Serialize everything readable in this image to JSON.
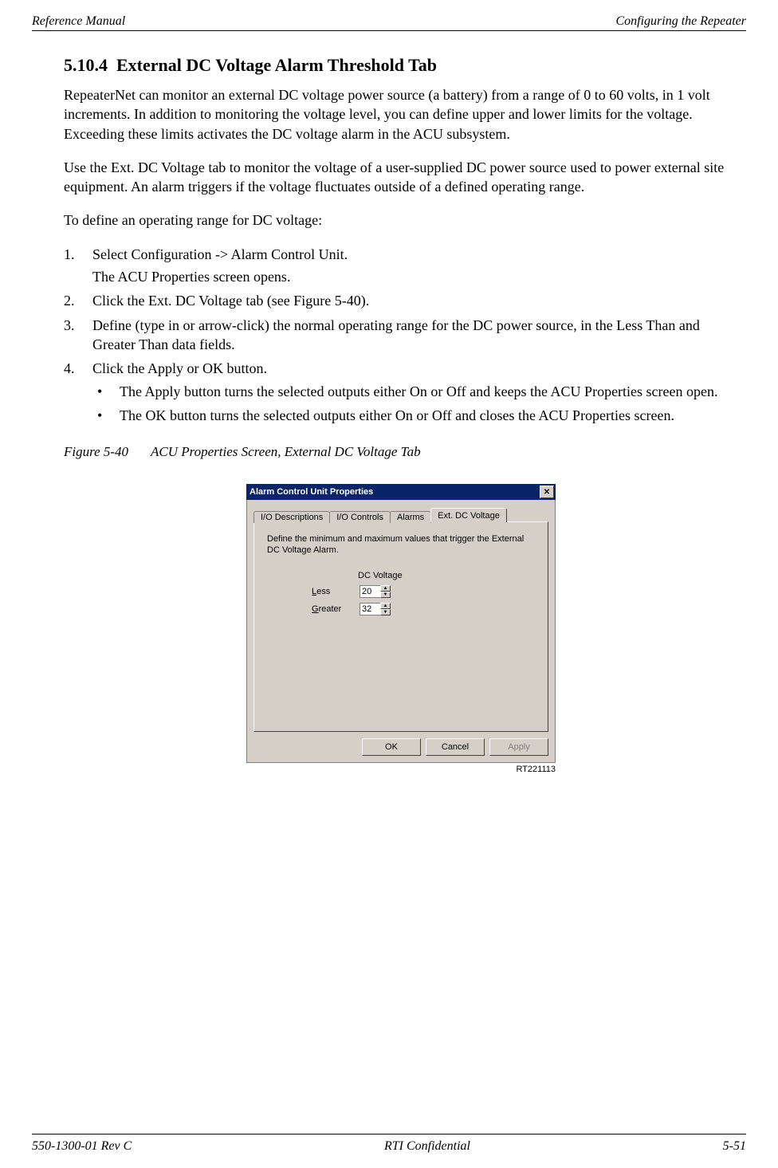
{
  "header": {
    "left": "Reference Manual",
    "right": "Configuring the Repeater"
  },
  "footer": {
    "left": "550-1300-01 Rev C",
    "center": "RTI Confidential",
    "right": "5-51"
  },
  "section": {
    "number": "5.10.4",
    "title": "External DC Voltage Alarm Threshold Tab"
  },
  "paras": {
    "p1": "RepeaterNet can monitor an external DC voltage power source (a battery) from a range of 0 to 60 volts, in 1 volt increments. In addition to monitoring the voltage level, you can define upper and lower limits for the voltage. Exceeding these limits activates the DC voltage alarm in the ACU subsystem.",
    "p2": "Use the Ext. DC Voltage tab to monitor the voltage of a user-supplied DC power source used to power external site equipment. An alarm triggers if the voltage fluctuates outside of a defined operating range.",
    "p3": "To define an operating range for DC voltage:"
  },
  "steps": {
    "s1": "Select Configuration -> Alarm Control Unit.",
    "s1b": "The ACU Properties screen opens.",
    "s2": "Click the Ext. DC Voltage tab (see Figure 5-40).",
    "s3": "Define (type in or arrow-click) the normal operating range for the DC power source, in the Less Than and Greater Than data fields.",
    "s4": "Click the Apply or OK button.",
    "b1": "The Apply button turns the selected outputs either On or Off and keeps the ACU Properties screen open.",
    "b2": "The OK button turns the selected outputs either On or Off and closes the ACU Properties screen."
  },
  "figure": {
    "ref": "Figure 5-40",
    "title": "ACU Properties Screen, External DC Voltage Tab",
    "image_ref": "RT221113"
  },
  "dialog": {
    "title": "Alarm Control Unit Properties",
    "close": "✕",
    "tabs": {
      "t1": "I/O Descriptions",
      "t2": "I/O Controls",
      "t3": "Alarms",
      "t4": "Ext. DC Voltage"
    },
    "panel_text": "Define the minimum and maximum values that trigger the External DC Voltage Alarm.",
    "col_heading": "DC Voltage",
    "less_label_u": "L",
    "less_label_rest": "ess",
    "greater_label_u": "G",
    "greater_label_rest": "reater",
    "less_value": "20",
    "greater_value": "32",
    "spin_up": "▲",
    "spin_down": "▼",
    "btn_ok": "OK",
    "btn_cancel": "Cancel",
    "btn_apply": "Apply"
  }
}
